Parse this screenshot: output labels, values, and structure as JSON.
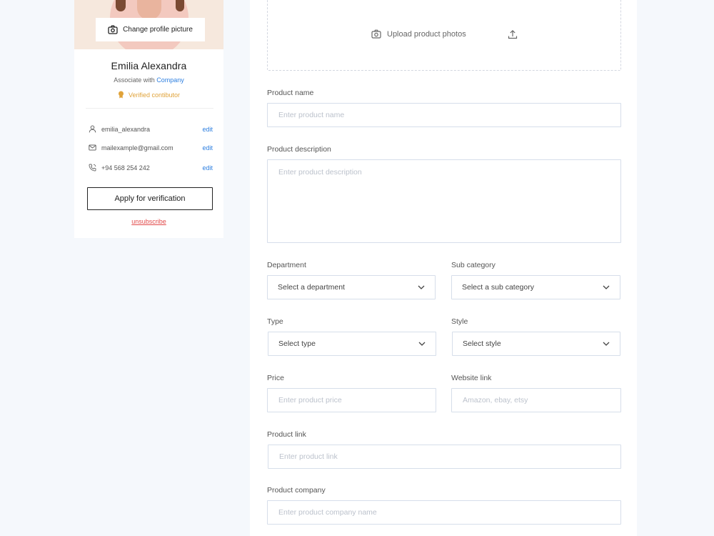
{
  "profile": {
    "change_picture_label": "Change profile picture",
    "name": "Emilia Alexandra",
    "associate_prefix": "Associate with",
    "company": "Company",
    "verified_label": "Verified contibutor",
    "contacts": [
      {
        "icon": "user-icon",
        "value": "emilia_alexandra",
        "action": "edit"
      },
      {
        "icon": "mail-icon",
        "value": "mailexample@gmail.com",
        "action": "edit"
      },
      {
        "icon": "phone-icon",
        "value": "+94 568 254 242",
        "action": "edit"
      }
    ],
    "verify_button": "Apply for verification",
    "unsubscribe": "unsubscribe",
    "colors": {
      "accent": "#2d7fe0",
      "verified": "#e0a33a",
      "danger": "#e24b4b"
    }
  },
  "form": {
    "upload_label": "Upload product photos",
    "product_name": {
      "label": "Product name",
      "placeholder": "Enter product name"
    },
    "product_description": {
      "label": "Product description",
      "placeholder": "Enter product description"
    },
    "department": {
      "label": "Department",
      "value": "Select a department"
    },
    "sub_category": {
      "label": "Sub category",
      "value": "Select a sub category"
    },
    "type": {
      "label": "Type",
      "value": "Select type"
    },
    "style": {
      "label": "Style",
      "value": "Select style"
    },
    "price": {
      "label": "Price",
      "placeholder": "Enter product price"
    },
    "website_link": {
      "label": "Website link",
      "placeholder": "Amazon, ebay, etsy"
    },
    "product_link": {
      "label": "Product link",
      "placeholder": "Enter product link"
    },
    "product_company": {
      "label": "Product company",
      "placeholder": "Enter product company name"
    }
  }
}
